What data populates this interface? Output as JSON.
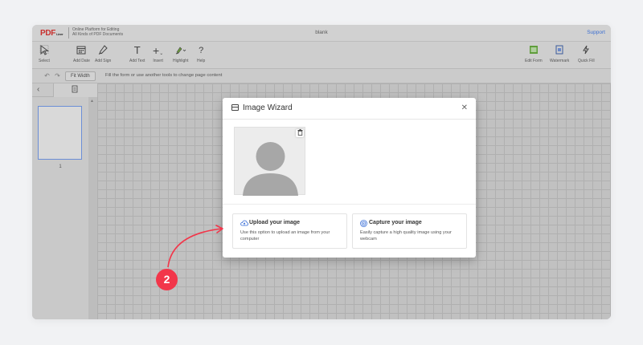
{
  "app": {
    "logo": "PDF",
    "logo_small": "Liner",
    "tagline_line1": "Online Platform for Editing",
    "tagline_line2": "All Kinds of PDF Documents",
    "document_title": "blank",
    "support_label": "Support"
  },
  "toolbar": {
    "tools": [
      {
        "name": "select",
        "label": "Select",
        "icon": "cursor-icon"
      },
      {
        "name": "add-date",
        "label": "Add Date",
        "icon": "calendar-icon"
      },
      {
        "name": "add-sign",
        "label": "Add Sign",
        "icon": "pen-icon"
      },
      {
        "name": "add-text",
        "label": "Add Text",
        "icon": "text-icon"
      },
      {
        "name": "insert",
        "label": "Insert",
        "icon": "plus-icon"
      },
      {
        "name": "highlight",
        "label": "Highlight",
        "icon": "highlighter-icon"
      },
      {
        "name": "help",
        "label": "Help",
        "icon": "question-icon"
      }
    ],
    "right_tools": [
      {
        "name": "edit-form",
        "label": "Edit Form",
        "icon": "form-icon"
      },
      {
        "name": "watermark",
        "label": "Watermark",
        "icon": "watermark-icon"
      },
      {
        "name": "quick-fill",
        "label": "Quick Fill",
        "icon": "lightning-icon"
      }
    ]
  },
  "subbar": {
    "fit_width_label": "Fit Width",
    "hint": "Fill the form or use another tools to change page content"
  },
  "sidebar": {
    "page_number": "1"
  },
  "modal": {
    "title": "Image Wizard",
    "options": {
      "upload": {
        "title": "Upload your image",
        "description": "Use this option to upload an image from your computer",
        "icon": "cloud-upload-icon"
      },
      "capture": {
        "title": "Capture your image",
        "description": "Easily capture a high quality image using your webcam",
        "icon": "webcam-icon"
      }
    }
  },
  "annotation": {
    "step_number": "2",
    "badge_color": "#f2364a"
  },
  "colors": {
    "accent": "#3a6fd8",
    "logo_red": "#c8312f"
  }
}
